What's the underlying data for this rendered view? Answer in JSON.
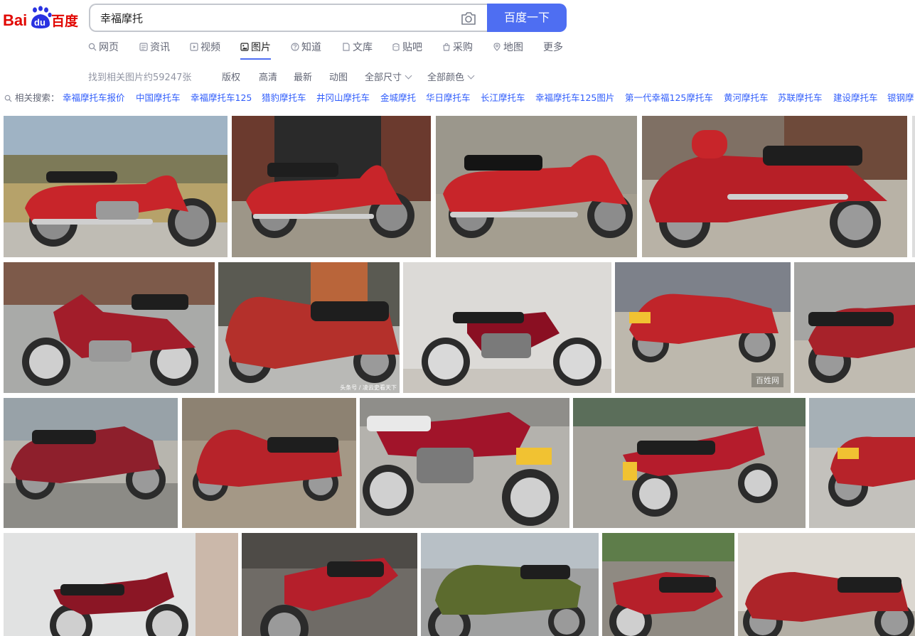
{
  "logo": {
    "text_left": "Bai",
    "text_paw": "du",
    "text_right": "百度"
  },
  "search": {
    "value": "幸福摩托",
    "button_label": "百度一下"
  },
  "tabs": [
    {
      "label": "网页",
      "icon": "search-icon"
    },
    {
      "label": "资讯",
      "icon": "news-icon"
    },
    {
      "label": "视频",
      "icon": "video-icon"
    },
    {
      "label": "图片",
      "icon": "image-icon",
      "active": true
    },
    {
      "label": "知道",
      "icon": "question-icon"
    },
    {
      "label": "文库",
      "icon": "doc-icon"
    },
    {
      "label": "贴吧",
      "icon": "tieba-icon"
    },
    {
      "label": "采购",
      "icon": "bag-icon"
    },
    {
      "label": "地图",
      "icon": "map-icon"
    },
    {
      "label": "更多"
    }
  ],
  "filters": {
    "found": "找到相关图片约59247张",
    "items": [
      "版权",
      "高清",
      "最新",
      "动图",
      "全部尺寸",
      "全部颜色"
    ]
  },
  "related": {
    "label": "相关搜索：",
    "items": [
      "幸福摩托车报价",
      "中国摩托车",
      "幸福摩托车125",
      "猎豹摩托车",
      "井冈山摩托车",
      "金城摩托",
      "华日摩托车",
      "长江摩托车",
      "幸福摩托车125图片",
      "第一代幸福125摩托车",
      "黄河摩托车",
      "苏联摩托车",
      "建设摩托车",
      "银钢摩"
    ]
  },
  "watermarks": {
    "tile_6": "头条号 / 凌云史看天下",
    "tile_8": "百姓网"
  },
  "colors": {
    "accent": "#4e6ef2",
    "link": "#315efb",
    "bike_red": "#c8252a",
    "bike_green": "#5c6b2e"
  }
}
